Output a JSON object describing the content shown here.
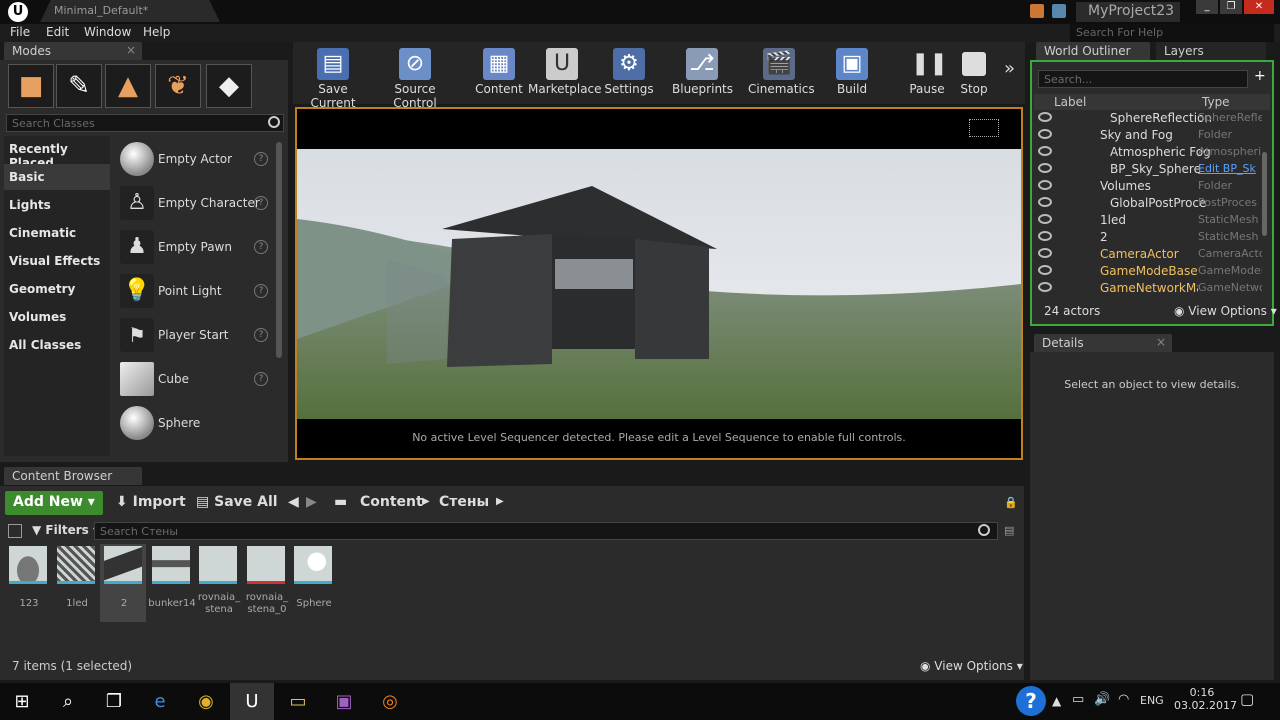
{
  "titlebar": {
    "doc_tab": "Minimal_Default*",
    "project_name": "MyProject23",
    "logo": "U"
  },
  "menu": {
    "items": [
      "File",
      "Edit",
      "Window",
      "Help"
    ],
    "search_placeholder": "Search For Help"
  },
  "modes": {
    "tab_label": "Modes",
    "search_placeholder": "Search Classes",
    "categories": [
      "Recently Placed",
      "Basic",
      "Lights",
      "Cinematic",
      "Visual Effects",
      "Geometry",
      "Volumes",
      "All Classes"
    ],
    "selected_category": "Basic",
    "items": [
      "Empty Actor",
      "Empty Character",
      "Empty Pawn",
      "Point Light",
      "Player Start",
      "Cube",
      "Sphere"
    ]
  },
  "toolbar": {
    "buttons": [
      "Save Current",
      "Source Control",
      "Content",
      "Marketplace",
      "Settings",
      "Blueprints",
      "Cinematics",
      "Build",
      "Pause",
      "Stop"
    ]
  },
  "viewport": {
    "message": "No active Level Sequencer detected. Please edit a Level Sequence to enable full controls."
  },
  "outliner": {
    "tab_label": "World Outliner",
    "layers_tab": "Layers",
    "search_placeholder": "Search...",
    "col_label": "Label",
    "col_type": "Type",
    "rows": [
      {
        "label": "SphereReflection",
        "type": "SphereRefle"
      },
      {
        "label": "Sky and Fog",
        "type": "Folder"
      },
      {
        "label": "Atmospheric Fog",
        "type": "Atmospheri"
      },
      {
        "label": "BP_Sky_Sphere",
        "type": "Edit BP_Sk"
      },
      {
        "label": "Volumes",
        "type": "Folder"
      },
      {
        "label": "GlobalPostProce",
        "type": "PostProces"
      },
      {
        "label": "1led",
        "type": "StaticMesh"
      },
      {
        "label": "2",
        "type": "StaticMesh"
      },
      {
        "label": "CameraActor",
        "type": "CameraActo"
      },
      {
        "label": "GameModeBase",
        "type": "GameModeB"
      },
      {
        "label": "GameNetworkMana",
        "type": "GameNetwo"
      }
    ],
    "actor_count": "24 actors",
    "view_options": "View Options"
  },
  "details": {
    "tab_label": "Details",
    "empty_message": "Select an object to view details."
  },
  "content_browser": {
    "tab_label": "Content Browser",
    "add_new": "Add New",
    "import": "Import",
    "save_all": "Save All",
    "path": [
      "Content",
      "Стены"
    ],
    "filters": "Filters",
    "search_placeholder": "Search Стены",
    "assets": [
      "123",
      "1led",
      "2",
      "bunker14",
      "rovnaia_\nstena",
      "rovnaia_\nstena_0",
      "Sphere"
    ],
    "selected_asset": "2",
    "status": "7 items (1 selected)",
    "view_options": "View Options"
  },
  "taskbar": {
    "language": "ENG",
    "time": "0:16",
    "date": "03.02.2017"
  },
  "colors": {
    "accent_orange": "#c08020",
    "add_new_green": "#3c8c2e",
    "outliner_border": "#3aaa3a"
  }
}
